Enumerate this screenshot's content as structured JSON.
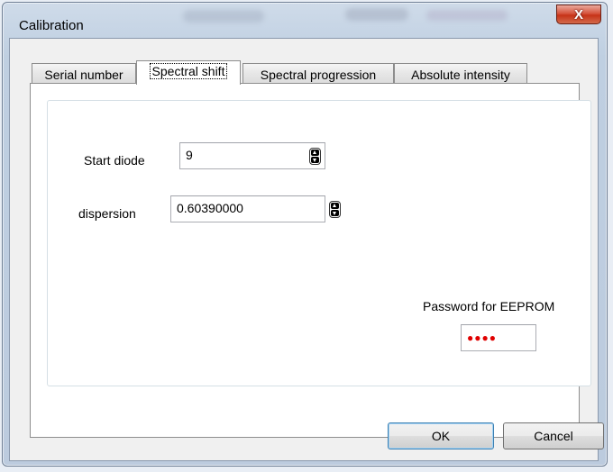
{
  "window": {
    "title": "Calibration",
    "close_label": "X"
  },
  "tabs": [
    {
      "label": "Serial number",
      "active": false
    },
    {
      "label": "Spectral shift",
      "active": true
    },
    {
      "label": "Spectral progression",
      "active": false
    },
    {
      "label": "Absolute intensity",
      "active": false
    }
  ],
  "fields": {
    "start_diode": {
      "label": "Start diode",
      "value": "9"
    },
    "dispersion": {
      "label": "dispersion",
      "value": "0.60390000"
    }
  },
  "password": {
    "label": "Password for EEPROM",
    "masked_value": "●●●●",
    "mask_color": "#e00000"
  },
  "buttons": {
    "ok": "OK",
    "cancel": "Cancel"
  },
  "icons": {
    "close": "close-icon",
    "spin": "spin-up-down-icon"
  }
}
